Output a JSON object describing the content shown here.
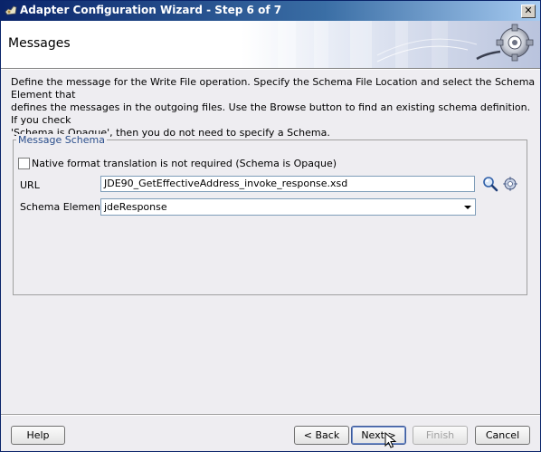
{
  "window": {
    "title": "Adapter Configuration Wizard - Step 6 of 7",
    "close_label": "✕"
  },
  "header": {
    "title": "Messages"
  },
  "description": "Define the message for the Write File operation.  Specify the Schema File Location and select the Schema Element that\ndefines the messages in the outgoing files. Use the Browse button to find an existing schema definition. If you check\n'Schema is Opaque', then you do not need to specify a Schema.",
  "message_schema": {
    "legend": "Message Schema",
    "opaque_checkbox": {
      "label": "Native format translation is not required (Schema is Opaque)",
      "checked": false
    },
    "url": {
      "label": "URL",
      "value": "JDE90_GetEffectiveAddress_invoke_response.xsd"
    },
    "schema_element": {
      "label": "Schema Element",
      "value": "jdeResponse"
    }
  },
  "buttons": {
    "help": "Help",
    "back": "< Back",
    "next": "Next >",
    "finish": "Finish",
    "cancel": "Cancel"
  }
}
